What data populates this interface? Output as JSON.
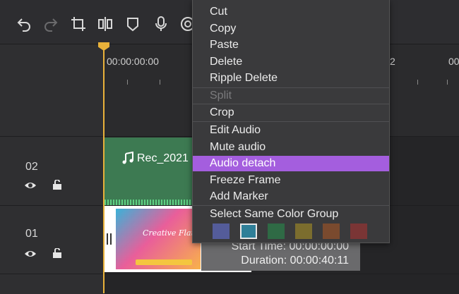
{
  "timeline": {
    "ruler_start": "00:00:00:00",
    "ruler_right_fragment": "2",
    "ruler_edge_fragment": "00"
  },
  "tracks": [
    {
      "number": "02",
      "clip_title": "Rec_2021"
    },
    {
      "number": "01"
    }
  ],
  "video_thumbnail_text": "Creative Flat",
  "tooltip": {
    "start_time": "Start Time: 00:00:00:00",
    "duration": "Duration: 00:00:40:11"
  },
  "context_menu": {
    "items": [
      "Cut",
      "Copy",
      "Paste",
      "Delete",
      "Ripple Delete",
      "Split",
      "Crop",
      "Edit Audio",
      "Mute audio",
      "Audio detach",
      "Freeze Frame",
      "Add Marker",
      "Select Same Color Group"
    ],
    "disabled_item": "Split",
    "highlighted_item": "Audio detach",
    "color_swatches": [
      "#545c9a",
      "#2f7f98",
      "#2f6a45",
      "#7b6d2e",
      "#7a4a2e",
      "#7a3535"
    ],
    "selected_swatch": "#2f7f98"
  },
  "colors": {
    "playhead": "#e8b13a",
    "highlight": "#a45ede",
    "audio_clip": "#3d7a52"
  }
}
